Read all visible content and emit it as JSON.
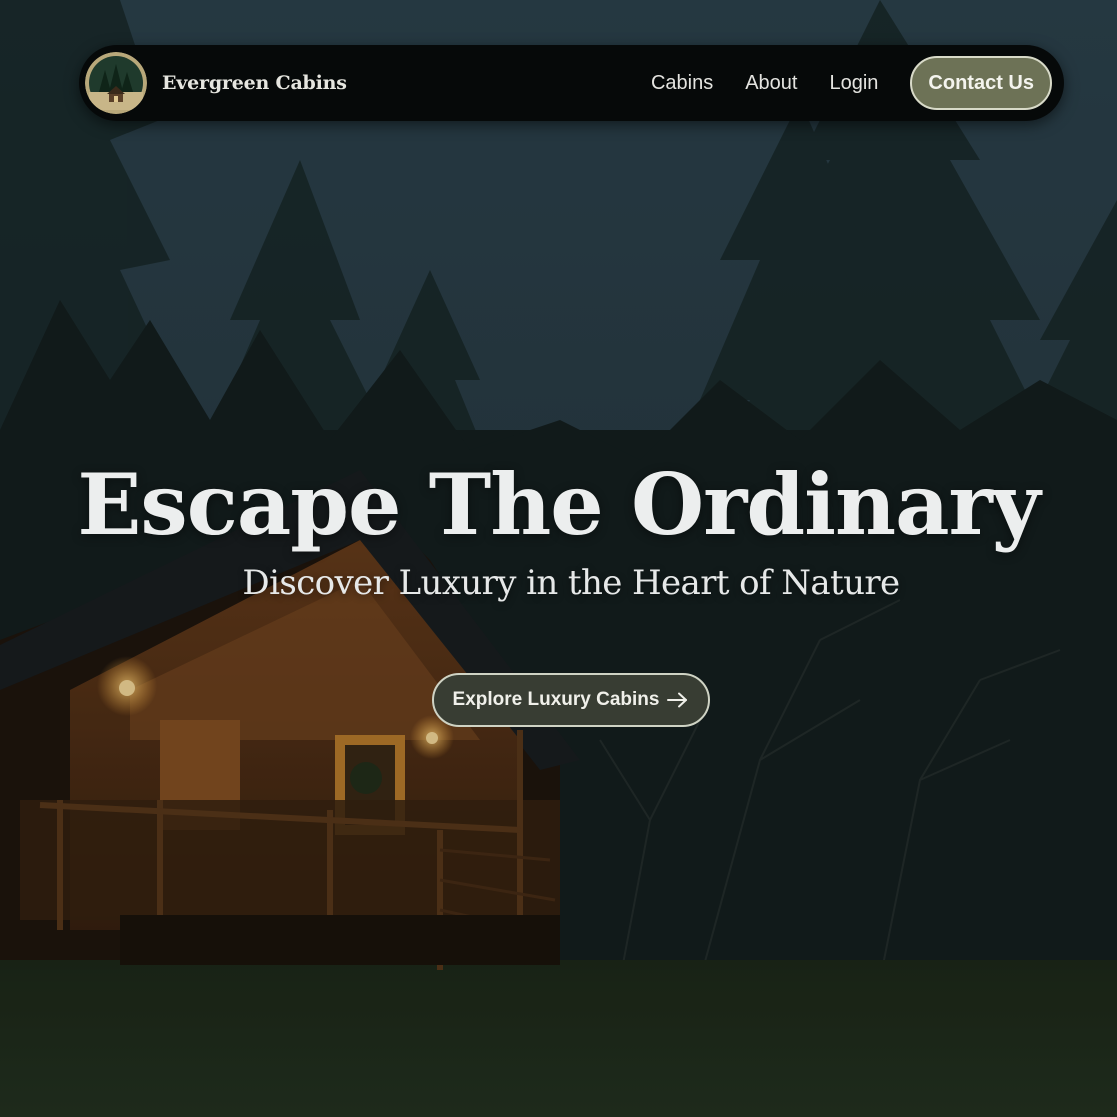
{
  "brand": {
    "name": "Evergreen Cabins",
    "logo_icon": "cabin-forest-logo-icon"
  },
  "nav": {
    "links": [
      {
        "label": "Cabins"
      },
      {
        "label": "About"
      },
      {
        "label": "Login"
      }
    ],
    "contact_label": "Contact Us"
  },
  "hero": {
    "title": "Escape The Ordinary",
    "subtitle": "Discover Luxury in the Heart of Nature",
    "cta_label": "Explore Luxury Cabins",
    "cta_icon": "arrow-right-icon",
    "background_icon": "cabin-in-forest-at-dusk-photo"
  },
  "colors": {
    "nav_background": "#060909",
    "contact_button": "#6d7256",
    "cta_button": "#383d33",
    "text": "#eceeee"
  }
}
